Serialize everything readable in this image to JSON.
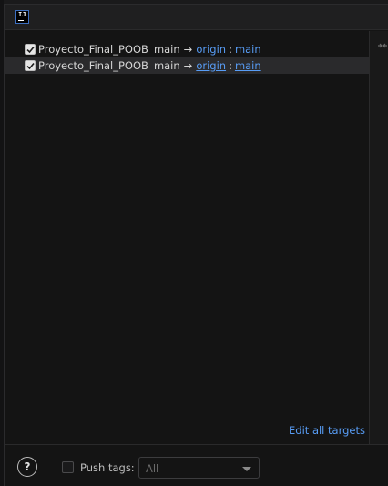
{
  "window": {
    "app_icon": "intellij-icon"
  },
  "push_rows": [
    {
      "checked": true,
      "repository": "Proyecto_Final_POOB",
      "branch": "main",
      "arrow": "→",
      "remote": "origin",
      "separator": ":",
      "target_branch": "main"
    },
    {
      "checked": true,
      "repository": "Proyecto_Final_POOB",
      "branch": "main",
      "arrow": "→",
      "remote": "origin",
      "separator": ":",
      "target_branch": "main"
    }
  ],
  "edit_all_label": "Edit all targets",
  "footer": {
    "help_label": "?",
    "push_tags": {
      "label": "Push tags:",
      "checked": false
    },
    "tags_select": {
      "value": "All"
    }
  },
  "colors": {
    "accent": "#589df6",
    "background": "#141414",
    "selected_row": "#2a2a2c"
  }
}
